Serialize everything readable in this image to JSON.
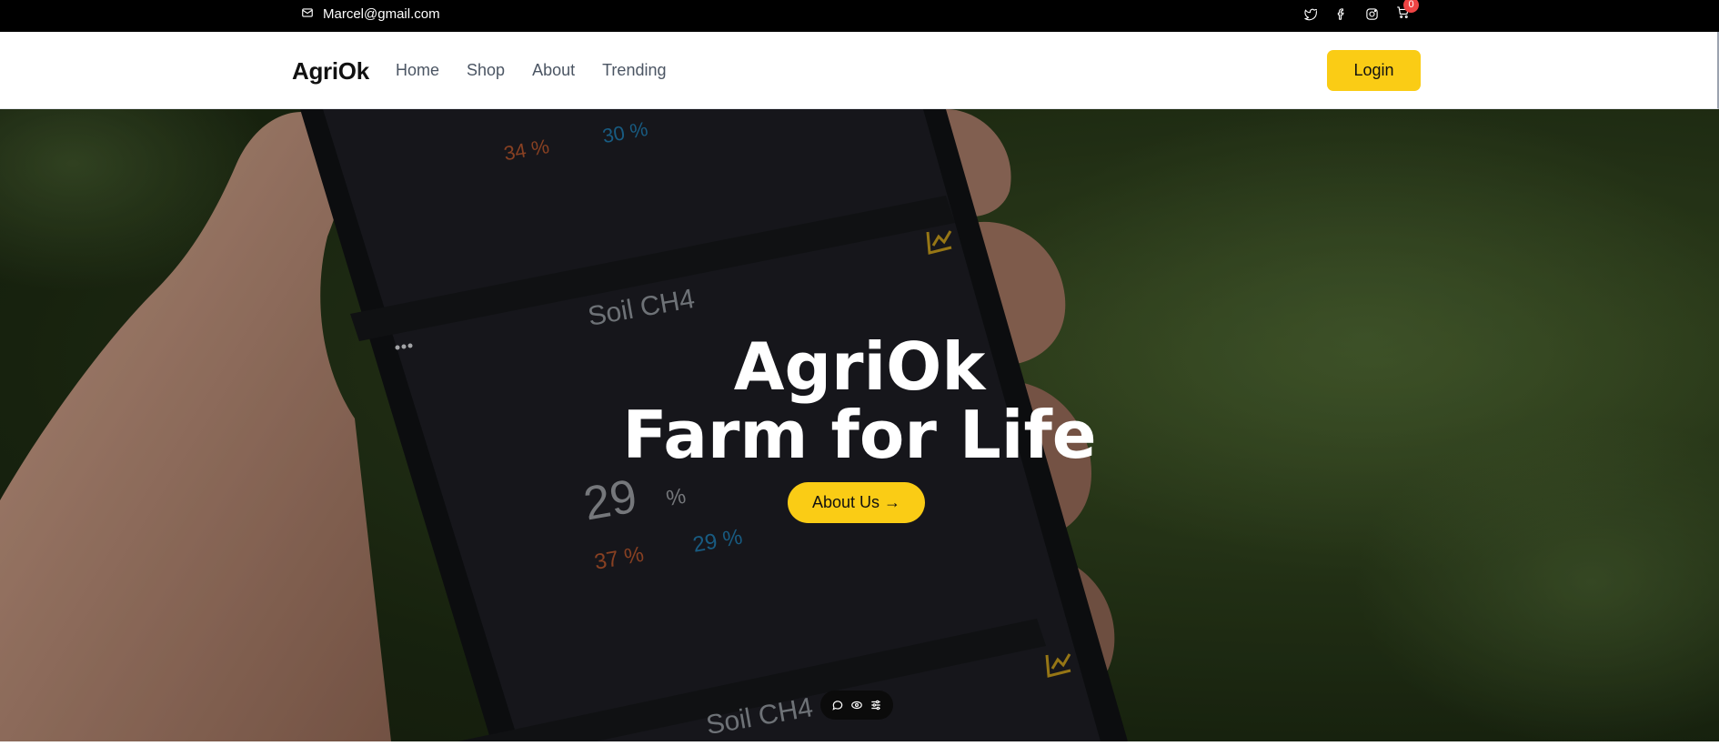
{
  "topbar": {
    "email": "Marcel@gmail.com",
    "icons": [
      "mail-icon",
      "twitter-icon",
      "facebook-icon",
      "instagram-icon",
      "cart-icon"
    ],
    "cart_count": "0"
  },
  "nav": {
    "brand": "AgriOk",
    "links": [
      "Home",
      "Shop",
      "About",
      "Trending"
    ],
    "login_label": "Login"
  },
  "hero": {
    "title_line1": "AgriOk",
    "title_line2": "Farm for Life",
    "cta_label": "About Us →",
    "phone_screen": {
      "top_reading_hi": "34 %",
      "top_reading_lo": "30 %",
      "section1_label": "Soil CH4",
      "value": "29",
      "unit": "%",
      "reading_hi": "37 %",
      "reading_lo": "29 %",
      "section2_label": "Soil CH4"
    }
  },
  "toolbar": {
    "icons": [
      "comment-icon",
      "eye-icon",
      "sliders-icon"
    ]
  },
  "colors": {
    "accent": "#facc15",
    "topbar_bg": "#000000",
    "badge": "#ef4444",
    "hero_green": "#2c3d1b"
  }
}
